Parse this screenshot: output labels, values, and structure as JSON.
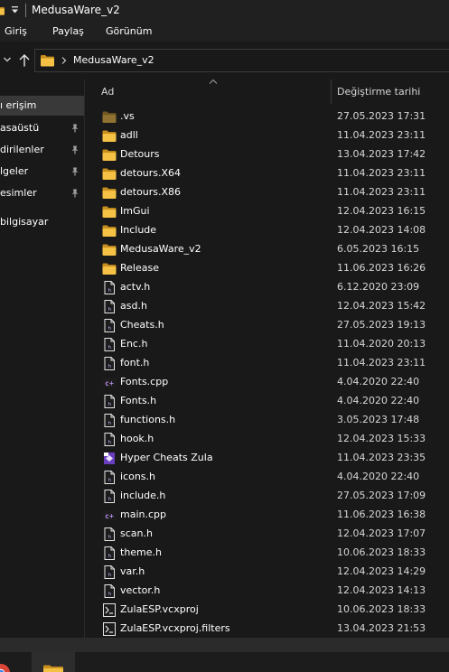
{
  "window": {
    "title": "MedusaWare_v2"
  },
  "ribbon": {
    "tabs": [
      "Giriş",
      "Paylaş",
      "Görünüm"
    ]
  },
  "address": {
    "path": "MedusaWare_v2"
  },
  "sidebar": {
    "items": [
      {
        "label": "ı erişim",
        "pinned": false
      },
      {
        "label": "asaüstü",
        "pinned": true
      },
      {
        "label": "dirilenler",
        "pinned": true
      },
      {
        "label": "lgeler",
        "pinned": true
      },
      {
        "label": "esimler",
        "pinned": true
      },
      {
        "label": "bilgisayar",
        "pinned": false
      }
    ]
  },
  "columns": {
    "name": "Ad",
    "modified": "Değiştirme tarihi"
  },
  "files": [
    {
      "name": ".vs",
      "date": "27.05.2023 17:31",
      "icon": "folder-hidden-icon"
    },
    {
      "name": "adll",
      "date": "11.04.2023 23:11",
      "icon": "folder-icon"
    },
    {
      "name": "Detours",
      "date": "13.04.2023 17:42",
      "icon": "folder-icon"
    },
    {
      "name": "detours.X64",
      "date": "11.04.2023 23:11",
      "icon": "folder-icon"
    },
    {
      "name": "detours.X86",
      "date": "11.04.2023 23:11",
      "icon": "folder-icon"
    },
    {
      "name": "ImGui",
      "date": "12.04.2023 16:15",
      "icon": "folder-icon"
    },
    {
      "name": "Include",
      "date": "12.04.2023 14:08",
      "icon": "folder-icon"
    },
    {
      "name": "MedusaWare_v2",
      "date": "6.05.2023 16:15",
      "icon": "folder-icon"
    },
    {
      "name": "Release",
      "date": "11.06.2023 16:26",
      "icon": "folder-icon"
    },
    {
      "name": "actv.h",
      "date": "6.12.2020 23:09",
      "icon": "header-file-icon"
    },
    {
      "name": "asd.h",
      "date": "12.04.2023 15:42",
      "icon": "header-file-icon"
    },
    {
      "name": "Cheats.h",
      "date": "27.05.2023 19:13",
      "icon": "header-file-icon"
    },
    {
      "name": "Enc.h",
      "date": "11.04.2020 20:13",
      "icon": "header-file-icon"
    },
    {
      "name": "font.h",
      "date": "11.04.2023 23:11",
      "icon": "header-file-icon"
    },
    {
      "name": "Fonts.cpp",
      "date": "4.04.2020 22:40",
      "icon": "cpp-file-icon"
    },
    {
      "name": "Fonts.h",
      "date": "4.04.2020 22:40",
      "icon": "header-file-icon"
    },
    {
      "name": "functions.h",
      "date": "3.05.2023 17:48",
      "icon": "header-file-icon"
    },
    {
      "name": "hook.h",
      "date": "12.04.2023 15:33",
      "icon": "header-file-icon"
    },
    {
      "name": "Hyper Cheats Zula",
      "date": "11.04.2023 23:35",
      "icon": "visual-studio-solution-icon"
    },
    {
      "name": "icons.h",
      "date": "4.04.2020 22:40",
      "icon": "header-file-icon"
    },
    {
      "name": "include.h",
      "date": "27.05.2023 17:09",
      "icon": "header-file-icon"
    },
    {
      "name": "main.cpp",
      "date": "11.06.2023 16:38",
      "icon": "cpp-file-icon"
    },
    {
      "name": "scan.h",
      "date": "12.04.2023 17:07",
      "icon": "header-file-icon"
    },
    {
      "name": "theme.h",
      "date": "10.06.2023 18:33",
      "icon": "header-file-icon"
    },
    {
      "name": "var.h",
      "date": "12.04.2023 14:29",
      "icon": "header-file-icon"
    },
    {
      "name": "vector.h",
      "date": "12.04.2023 14:13",
      "icon": "header-file-icon"
    },
    {
      "name": "ZulaESP.vcxproj",
      "date": "10.06.2023 18:33",
      "icon": "vcxproj-file-icon"
    },
    {
      "name": "ZulaESP.vcxproj.filters",
      "date": "13.04.2023 21:53",
      "icon": "vcxproj-file-icon"
    }
  ],
  "colors": {
    "background": "#191919",
    "chrome": "#202020",
    "folder": "#e8b53a",
    "selection": "#393939",
    "text": "#ffffff",
    "text_secondary": "#d6d6d6"
  }
}
